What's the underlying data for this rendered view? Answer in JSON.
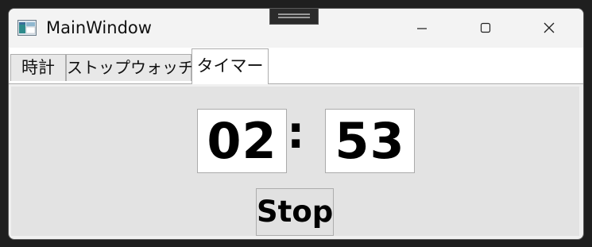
{
  "window": {
    "title": "MainWindow"
  },
  "tabs": {
    "clock_label": "時計",
    "stopwatch_label": "ストップウォッチ",
    "timer_label": "タイマー",
    "selected": "タイマー"
  },
  "timer": {
    "minutes": "02",
    "separator": ":",
    "seconds": "53",
    "stop_label": "Stop"
  },
  "icons": {
    "app": "app-window-icon",
    "minimize": "minimize-icon",
    "maximize": "maximize-icon",
    "close": "close-icon",
    "snap": "snap-layout-handle-icon"
  }
}
